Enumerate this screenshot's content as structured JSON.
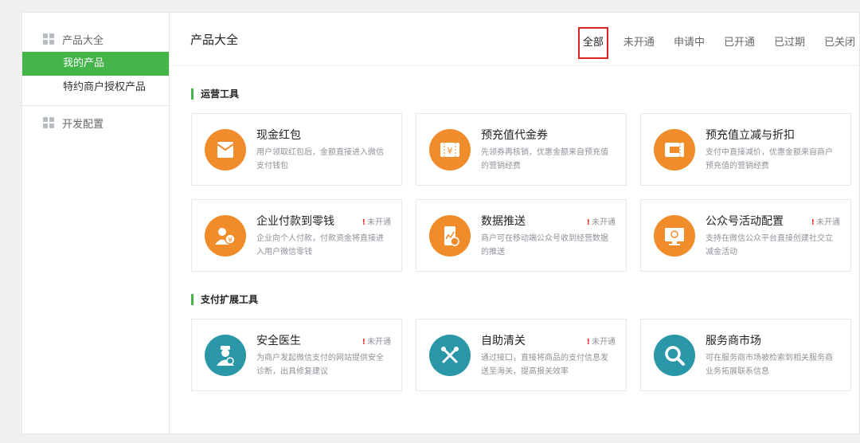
{
  "sidebar": {
    "group1": {
      "label": "产品大全",
      "icon": "grid-icon"
    },
    "items": [
      {
        "label": "我的产品",
        "active": true
      },
      {
        "label": "特约商户授权产品",
        "active": false
      }
    ],
    "group2": {
      "label": "开发配置",
      "icon": "grid-icon"
    }
  },
  "header": {
    "title": "产品大全",
    "tabs": [
      {
        "label": "全部",
        "active": true
      },
      {
        "label": "未开通"
      },
      {
        "label": "申请中"
      },
      {
        "label": "已开通"
      },
      {
        "label": "已过期"
      },
      {
        "label": "已关闭"
      }
    ]
  },
  "sections": [
    {
      "title": "运营工具",
      "cards": [
        {
          "name": "现金红包",
          "desc": "用户领取红包后，金额直接进入微信支付钱包",
          "status": "",
          "icon": "red-packet-icon",
          "color": "#f08c2a"
        },
        {
          "name": "预充值代金券",
          "desc": "先领券再核销，优惠金额来自预充值的营销经费",
          "status": "",
          "icon": "voucher-icon",
          "color": "#f08c2a"
        },
        {
          "name": "预充值立减与折扣",
          "desc": "支付中直接减价，优惠金额来自商户预充值的营销经费",
          "status": "",
          "icon": "discount-icon",
          "color": "#f08c2a"
        },
        {
          "name": "企业付款到零钱",
          "desc": "企业向个人付款，付款资金将直接进入用户微信零钱",
          "status": "未开通",
          "icon": "enterprise-pay-icon",
          "color": "#f08c2a"
        },
        {
          "name": "数据推送",
          "desc": "商户可在移动端公众号收到经营数据的推送",
          "status": "未开通",
          "icon": "data-push-icon",
          "color": "#f08c2a"
        },
        {
          "name": "公众号活动配置",
          "desc": "支持在微信公众平台直接创建社交立减金活动",
          "status": "未开通",
          "icon": "activity-config-icon",
          "color": "#f08c2a"
        }
      ]
    },
    {
      "title": "支付扩展工具",
      "cards": [
        {
          "name": "安全医生",
          "desc": "为商户发起微信支付的网站提供安全诊断，出具修复建议",
          "status": "未开通",
          "icon": "security-doctor-icon",
          "color": "#2a97a8"
        },
        {
          "name": "自助清关",
          "desc": "通过接口，直接将商品的支付信息发送至海关，提高报关效率",
          "status": "未开通",
          "icon": "customs-icon",
          "color": "#2a97a8"
        },
        {
          "name": "服务商市场",
          "desc": "可在服务商市场被检索到相关服务商业务拓展联系信息",
          "status": "",
          "icon": "search-icon",
          "color": "#2a97a8"
        }
      ]
    }
  ]
}
